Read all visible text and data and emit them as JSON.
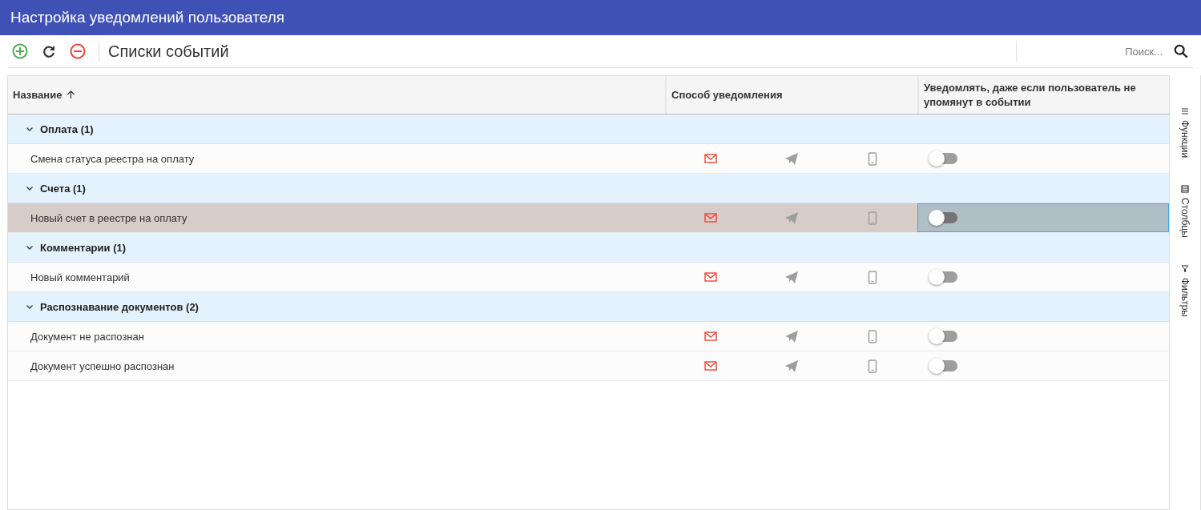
{
  "window": {
    "title": "Настройка уведомлений пользователя"
  },
  "toolbar": {
    "title": "Списки событий",
    "search": {
      "placeholder": "Поиск..."
    }
  },
  "table": {
    "columns": [
      {
        "label": "Название",
        "sorted_ascending": true
      },
      {
        "label": "Способ уведомления",
        "sorted_ascending": false
      },
      {
        "label": "Уведомлять, даже если пользователь не упомянут в событии",
        "sorted_ascending": false
      }
    ],
    "groups": [
      {
        "label": "Оплата (1)",
        "expanded": true,
        "rows": [
          {
            "name": "Смена статуса реестра на оплату",
            "selected": false,
            "email": true,
            "telegram": false,
            "phone": false,
            "notify_always": false
          }
        ]
      },
      {
        "label": "Счета (1)",
        "expanded": true,
        "rows": [
          {
            "name": "Новый счет в реестре на оплату",
            "selected": true,
            "email": true,
            "telegram": false,
            "phone": false,
            "notify_always": false
          }
        ]
      },
      {
        "label": "Комментарии (1)",
        "expanded": true,
        "rows": [
          {
            "name": "Новый комментарий",
            "selected": false,
            "email": true,
            "telegram": false,
            "phone": false,
            "notify_always": false
          }
        ]
      },
      {
        "label": "Распознавание документов (2)",
        "expanded": true,
        "rows": [
          {
            "name": "Документ не распознан",
            "selected": false,
            "email": true,
            "telegram": false,
            "phone": false,
            "notify_always": false
          },
          {
            "name": "Документ успешно распознан",
            "selected": false,
            "email": true,
            "telegram": false,
            "phone": false,
            "notify_always": false
          }
        ]
      }
    ]
  },
  "side_panel": [
    {
      "kind": "functions",
      "label": "Функции"
    },
    {
      "kind": "columns",
      "label": "Столбцы"
    },
    {
      "kind": "filters",
      "label": "Фильтры"
    }
  ]
}
